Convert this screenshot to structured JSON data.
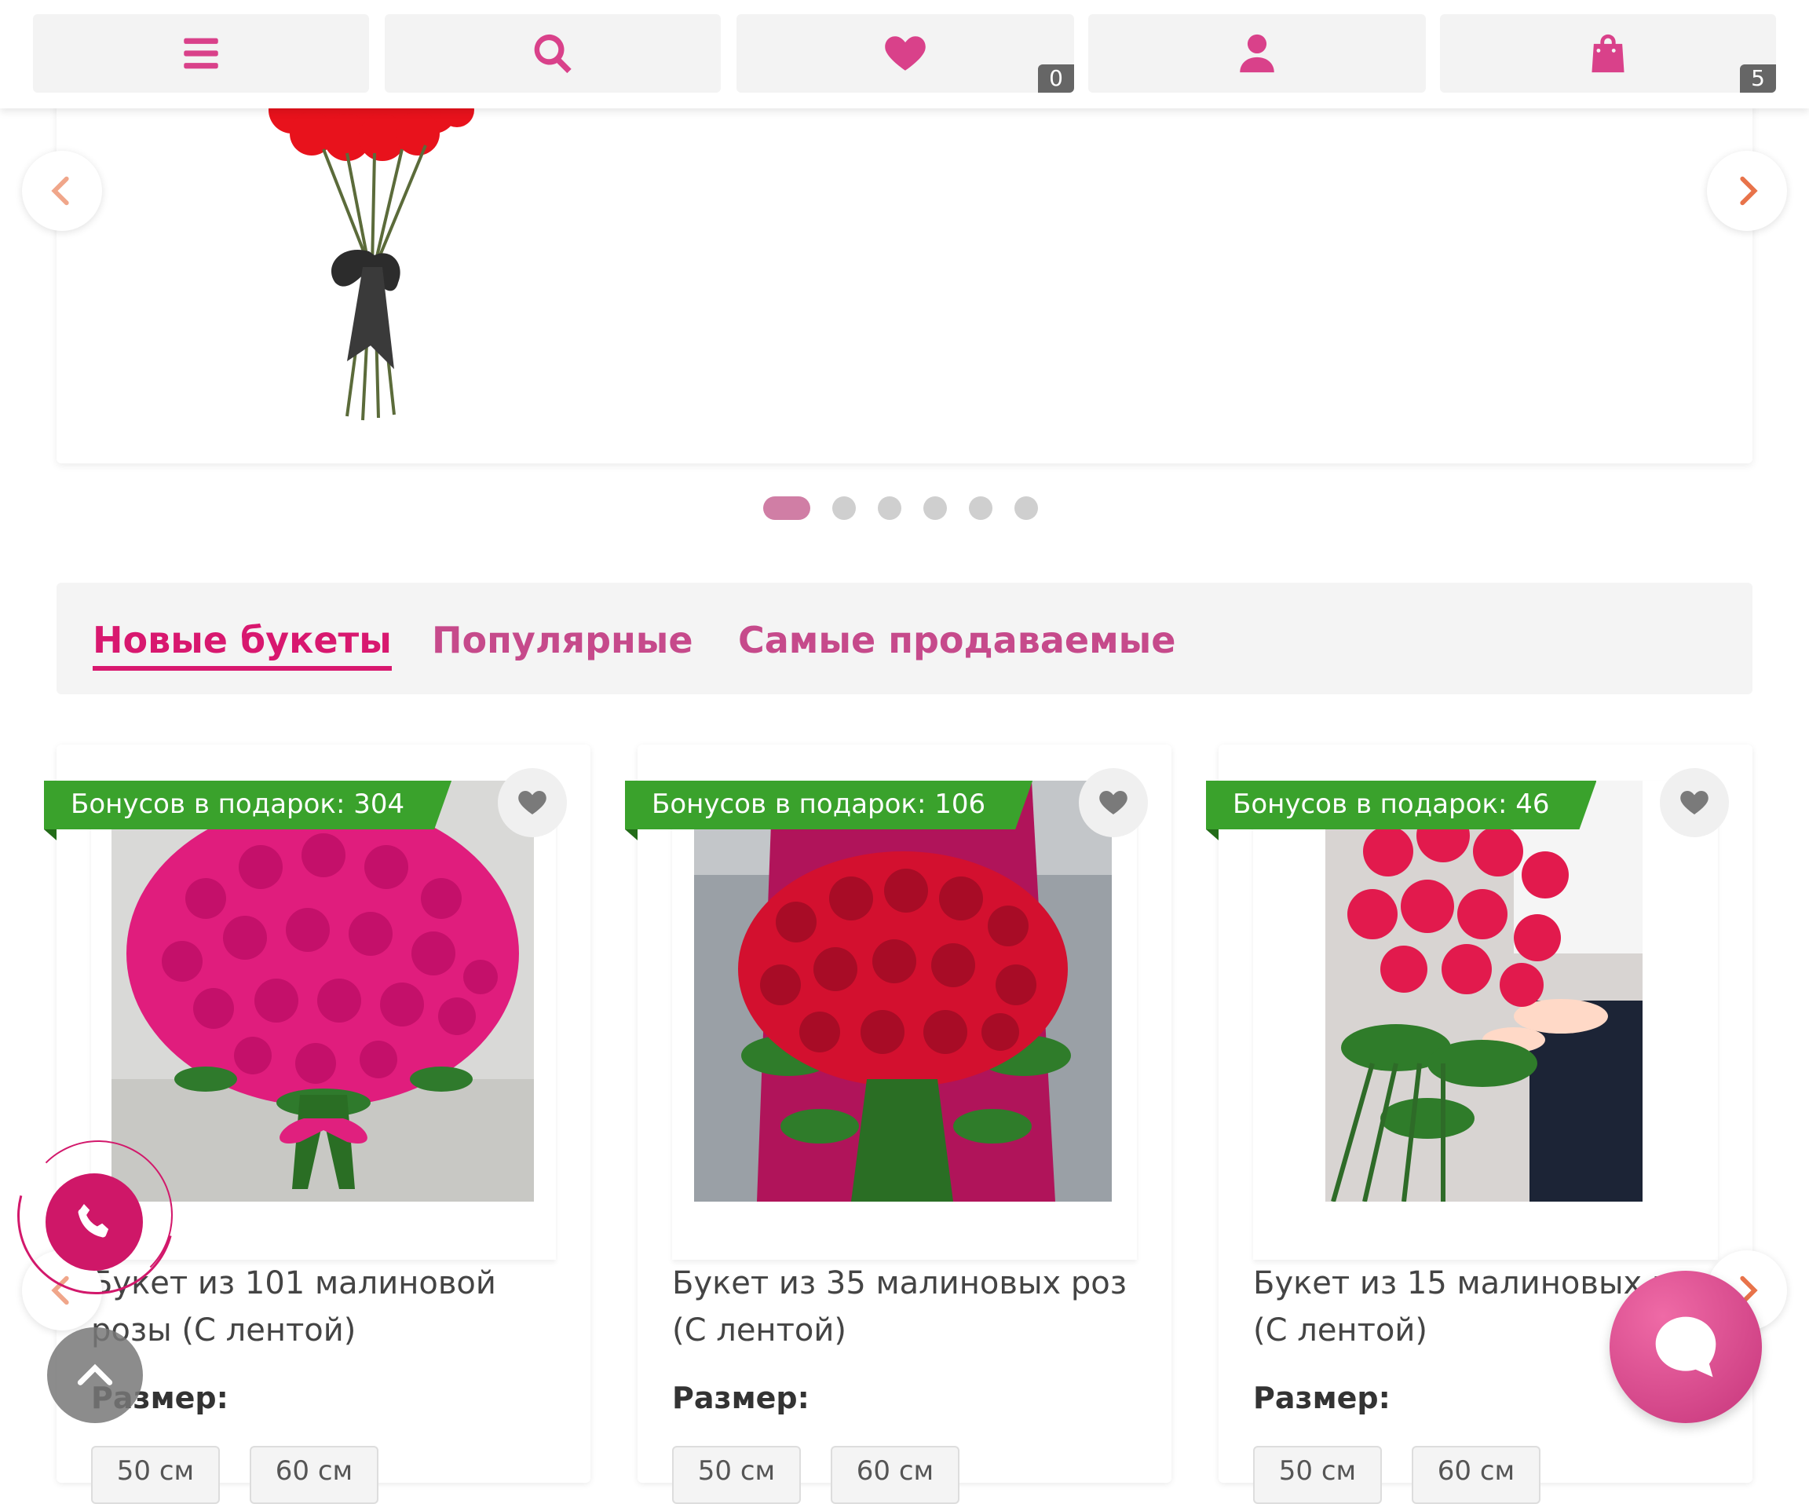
{
  "nav": {
    "favorites_count": "0",
    "cart_count": "5"
  },
  "tabs": [
    {
      "label": "Новые букеты",
      "active": true
    },
    {
      "label": "Популярные",
      "active": false
    },
    {
      "label": "Самые продаваемые",
      "active": false
    }
  ],
  "slider": {
    "slide_count": 6,
    "active_index": 0
  },
  "products": [
    {
      "bonus": "Бонусов в подарок: 304",
      "title": "Букет из 101 малиновой розы (С лентой)",
      "size_label": "Размер:",
      "sizes": [
        "50 см",
        "60 см"
      ]
    },
    {
      "bonus": "Бонусов в подарок: 106",
      "title": "Букет из 35 малиновых роз (С лентой)",
      "size_label": "Размер:",
      "sizes": [
        "50 см",
        "60 см"
      ]
    },
    {
      "bonus": "Бонусов в подарок: 46",
      "title": "Букет из 15 малиновых роз (С лентой)",
      "size_label": "Размер:",
      "sizes": [
        "50 см",
        "60 см"
      ]
    }
  ],
  "icons": [
    "menu-icon",
    "search-icon",
    "heart-icon",
    "user-icon",
    "shopping-bag-icon",
    "chevron-left-icon",
    "chevron-right-icon",
    "phone-icon",
    "chevron-up-icon",
    "chat-icon"
  ],
  "colors": {
    "accent": "#d8186f",
    "bonus_ribbon": "#3aa22c",
    "nav_icon": "#d9418a"
  }
}
